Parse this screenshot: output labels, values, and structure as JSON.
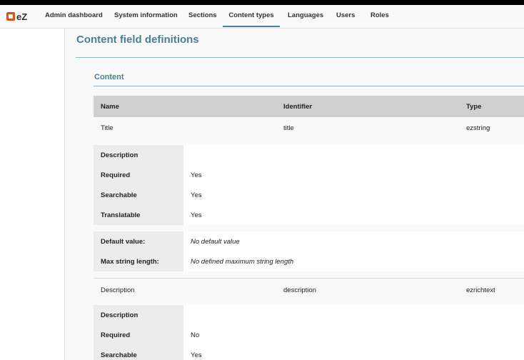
{
  "brand": "eZ",
  "nav": [
    {
      "label": "Admin dashboard"
    },
    {
      "label": "System information"
    },
    {
      "label": "Sections"
    },
    {
      "label": "Content types"
    },
    {
      "label": "Languages"
    },
    {
      "label": "Users"
    },
    {
      "label": "Roles"
    }
  ],
  "page_title": "Content field definitions",
  "group": "Content",
  "table_headers": {
    "name": "Name",
    "identifier": "Identifier",
    "type": "Type"
  },
  "fields": [
    {
      "name": "Title",
      "identifier": "title",
      "type": "ezstring",
      "props": [
        {
          "k": "Description",
          "v": ""
        },
        {
          "k": "Required",
          "v": "Yes"
        },
        {
          "k": "Searchable",
          "v": "Yes"
        },
        {
          "k": "Translatable",
          "v": "Yes"
        }
      ],
      "settings": [
        {
          "k": "Default value:",
          "v": "No default value"
        },
        {
          "k": "Max string length:",
          "v": "No defined maximum string length"
        }
      ]
    },
    {
      "name": "Description",
      "identifier": "description",
      "type": "ezrichtext",
      "props": [
        {
          "k": "Description",
          "v": ""
        },
        {
          "k": "Required",
          "v": "No"
        },
        {
          "k": "Searchable",
          "v": "Yes"
        }
      ]
    }
  ]
}
